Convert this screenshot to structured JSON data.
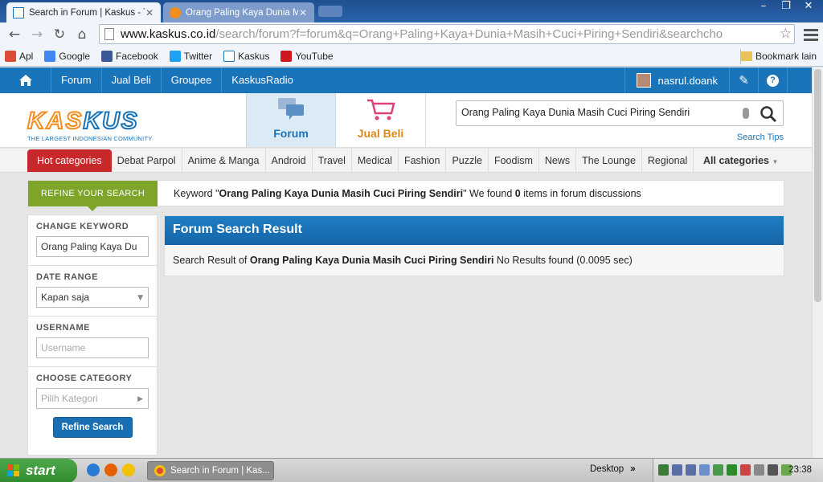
{
  "browser": {
    "tabs": [
      {
        "title": "Search in Forum | Kaskus - Tl",
        "active": true
      },
      {
        "title": "Orang Paling Kaya Dunia Ma:",
        "active": false
      }
    ],
    "window_controls": {
      "minimize": "–",
      "maximize": "❐",
      "close": "✕"
    },
    "url": {
      "host": "www.kaskus.co.id",
      "path": "/search/forum?f=forum&q=Orang+Paling+Kaya+Dunia+Masih+Cuci+Piring+Sendiri&searchcho"
    },
    "bookmarks": [
      {
        "label": "Apl",
        "color": "#dd4b39"
      },
      {
        "label": "Google",
        "color": "#4285f4"
      },
      {
        "label": "Facebook",
        "color": "#3b5998"
      },
      {
        "label": "Twitter",
        "color": "#1da1f2"
      },
      {
        "label": "Kaskus",
        "color": "#1a74ba"
      },
      {
        "label": "YouTube",
        "color": "#cc181e"
      }
    ],
    "other_bookmarks": "Bookmark lain"
  },
  "site": {
    "topnav": {
      "links": [
        "Forum",
        "Jual Beli",
        "Groupee",
        "KaskusRadio"
      ],
      "username": "nasrul.doank"
    },
    "logo": {
      "word_a": "KAS",
      "word_b": "KUS",
      "tagline": "THE LARGEST INDONESIAN COMMUNITY"
    },
    "header_tabs": {
      "forum": "Forum",
      "jual_beli": "Jual Beli"
    },
    "search": {
      "value": "Orang Paling Kaya Dunia Masih Cuci Piring Sendiri",
      "tips": "Search Tips"
    },
    "categories": {
      "hot": "Hot categories",
      "items": [
        "Debat Parpol",
        "Anime & Manga",
        "Android",
        "Travel",
        "Medical",
        "Fashion",
        "Puzzle",
        "Foodism",
        "News",
        "The Lounge",
        "Regional"
      ],
      "all": "All categories"
    },
    "refine": {
      "label": "REFINE YOUR SEARCH",
      "msg_prefix": "Keyword \"",
      "keyword": "Orang Paling Kaya Dunia Masih Cuci Piring Sendiri",
      "msg_mid": "\" We found ",
      "count": "0",
      "msg_suffix": " items in forum discussions"
    },
    "sidebar": {
      "change_keyword": "CHANGE KEYWORD",
      "keyword_value": "Orang Paling Kaya Du",
      "date_range": "DATE RANGE",
      "date_value": "Kapan saja",
      "username": "USERNAME",
      "username_placeholder": "Username",
      "category": "CHOOSE CATEGORY",
      "category_value": "Pilih Kategori",
      "button": "Refine Search"
    },
    "result": {
      "title": "Forum Search Result",
      "prefix": "Search Result of ",
      "keyword": "Orang Paling Kaya Dunia Masih Cuci Piring Sendiri",
      "suffix": " No Results found (0.0095 sec)"
    }
  },
  "taskbar": {
    "start": "start",
    "task": "Search in Forum | Kas...",
    "desktop": "Desktop",
    "desktop_arrow": "»",
    "clock": "23:38"
  }
}
